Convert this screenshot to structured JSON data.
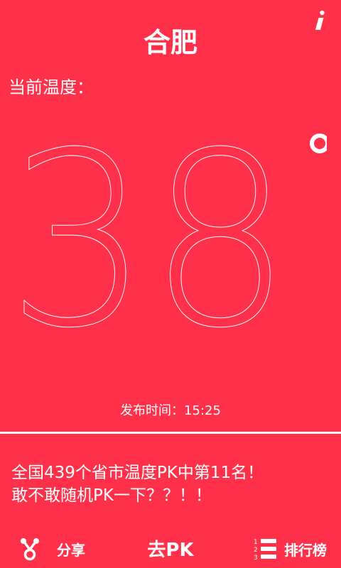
{
  "header": {
    "city": "合肥",
    "info_icon": "info-icon"
  },
  "temperature": {
    "label": "当前温度：",
    "value": "38",
    "unit_symbol": "°",
    "publish_label": "发布时间：15:25"
  },
  "ranking": {
    "line1": "全国439个省市温度PK中第11名！",
    "line2": "敢不敢随机PK一下？？！！"
  },
  "toolbar": {
    "share_label": "分享",
    "share_icon": "share-icon",
    "pk_label": "去PK",
    "rank_label": "排行榜",
    "rank_icon": "ranked-list-icon"
  },
  "colors": {
    "background": "#FF3049",
    "foreground": "#FFFFFF"
  }
}
